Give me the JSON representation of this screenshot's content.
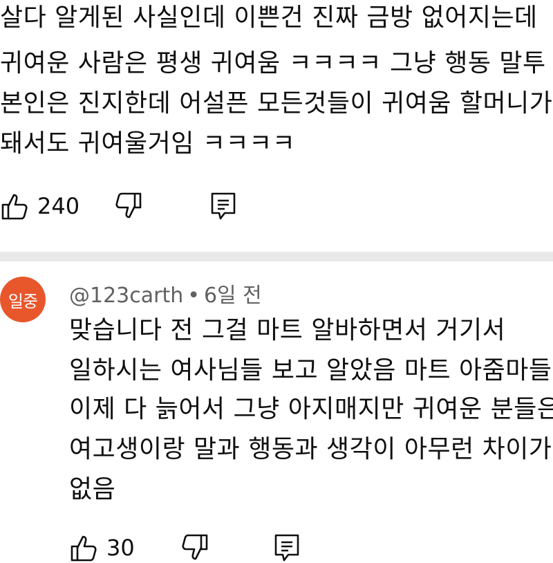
{
  "comment1": {
    "lines": [
      "살다 알게된 사실인데 이쁜건 진짜 금방 없어지는데",
      "귀여운 사람은 평생 귀여움 ㅋㅋㅋㅋ 그냥 행동 말투",
      "본인은 진지한데 어설픈 모든것들이 귀여움 할머니가",
      "돼서도 귀여울거임 ㅋㅋㅋㅋ"
    ],
    "like_count": "240",
    "icons": {
      "like": "thumbs-up-icon",
      "dislike": "thumbs-down-icon",
      "reply": "reply-icon"
    }
  },
  "comment2": {
    "avatar_text": "일중",
    "avatar_color": "#e8572c",
    "author": "@123carth",
    "separator": "•",
    "time": "6일 전",
    "lines": [
      "맞습니다 전 그걸 마트 알바하면서 거기서",
      "일하시는 여사님들 보고 알았음 마트 아줌마들",
      "이제 다 늙어서 그냥 아지매지만 귀여운 분들은",
      "여고생이랑 말과 행동과 생각이 아무런 차이가",
      "없음"
    ],
    "like_count": "30",
    "icons": {
      "like": "thumbs-up-icon",
      "dislike": "thumbs-down-icon",
      "reply": "reply-icon"
    }
  },
  "colors": {
    "separator": "#e9e9e9",
    "meta_text": "#606060",
    "text": "#0f0f0f"
  }
}
